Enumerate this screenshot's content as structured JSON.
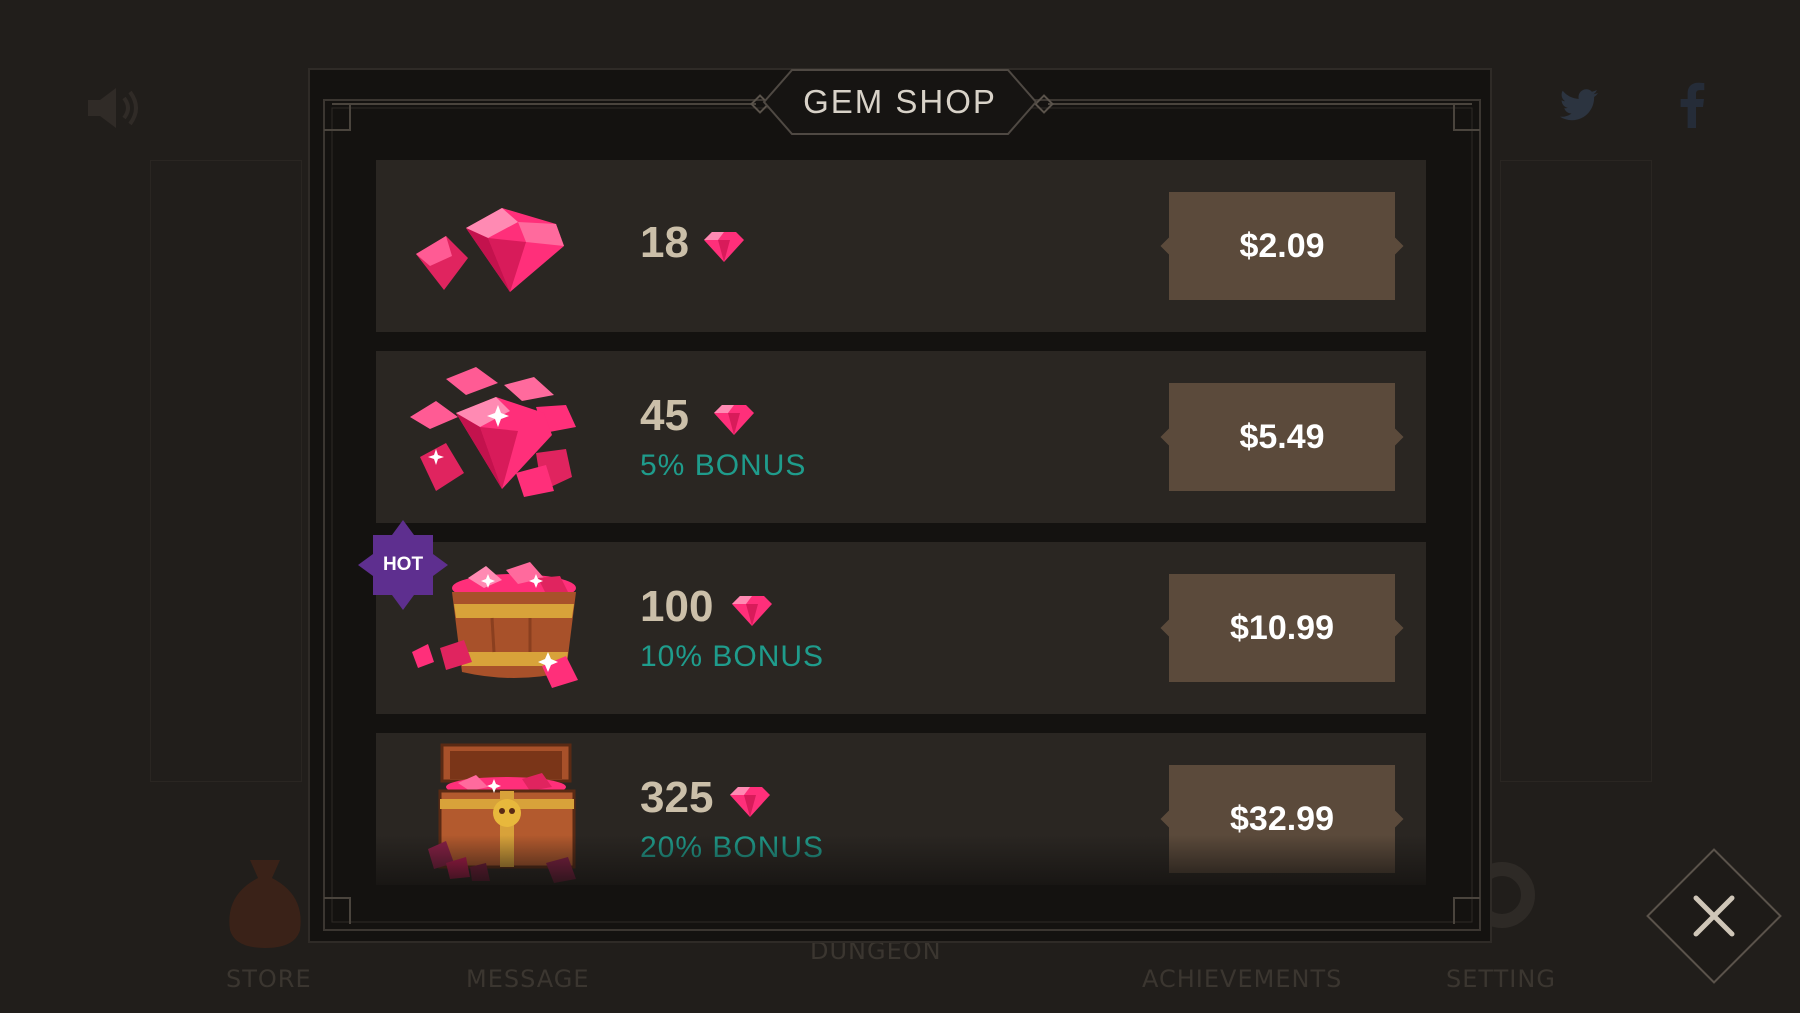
{
  "background": {
    "bottom_nav": [
      "STORE",
      "MESSAGE",
      "DUNGEON",
      "ACHIEVEMENTS",
      "SETTING"
    ],
    "icons": [
      "speaker-icon",
      "twitter-icon",
      "facebook-icon"
    ]
  },
  "shop": {
    "title": "GEM SHOP",
    "items": [
      {
        "amount": "18",
        "bonus": "",
        "price": "$2.09",
        "image": "small-gem-pile"
      },
      {
        "amount": "45",
        "bonus": "5% BONUS",
        "price": "$5.49",
        "image": "gem-pile"
      },
      {
        "amount": "100",
        "bonus": "10% BONUS",
        "price": "$10.99",
        "image": "gem-barrel",
        "badge": "HOT"
      },
      {
        "amount": "325",
        "bonus": "20% BONUS",
        "price": "$32.99",
        "image": "gem-treasure-chest"
      }
    ]
  },
  "colors": {
    "gem": "#ff2f7a",
    "bonus": "#1f9c8c",
    "price_button": "#5b4a3b",
    "hot_badge": "#5e2f8f"
  }
}
